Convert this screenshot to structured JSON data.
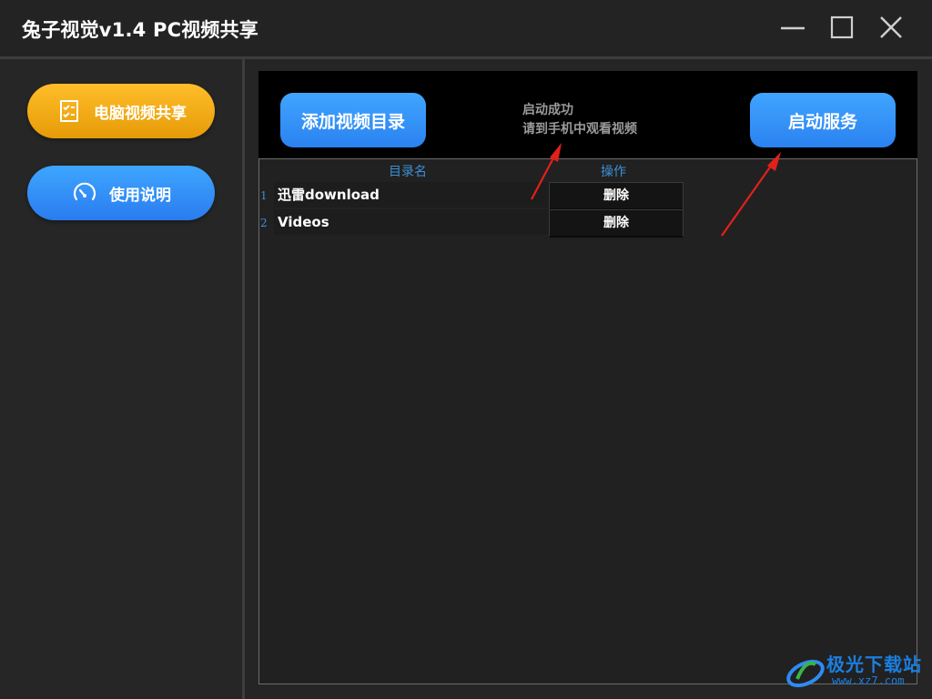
{
  "window": {
    "title": "兔子视觉v1.4 PC视频共享",
    "controls": [
      "minimize-icon",
      "maximize-icon",
      "close-icon"
    ]
  },
  "sidebar": {
    "items": [
      {
        "label": "电脑视频共享",
        "icon": "checklist-icon",
        "color": "#f0a913"
      },
      {
        "label": "使用说明",
        "icon": "gauge-icon",
        "color": "#2f8bf4"
      }
    ]
  },
  "toolbar": {
    "add_label": "添加视频目录",
    "start_label": "启动服务",
    "status_line1": "启动成功",
    "status_line2": "请到手机中观看视频"
  },
  "list": {
    "columns": [
      "目录名",
      "操作"
    ],
    "rows": [
      {
        "num": "1",
        "name": "迅雷download",
        "action": "删除"
      },
      {
        "num": "2",
        "name": "Videos",
        "action": "删除"
      }
    ]
  },
  "watermark": {
    "text": "极光下载站",
    "url": "www.xz7.com"
  },
  "colors": {
    "accent_blue": "#2f8bf4",
    "accent_orange": "#f0a913",
    "annotation_red": "#e3201b",
    "background": "#252525"
  }
}
